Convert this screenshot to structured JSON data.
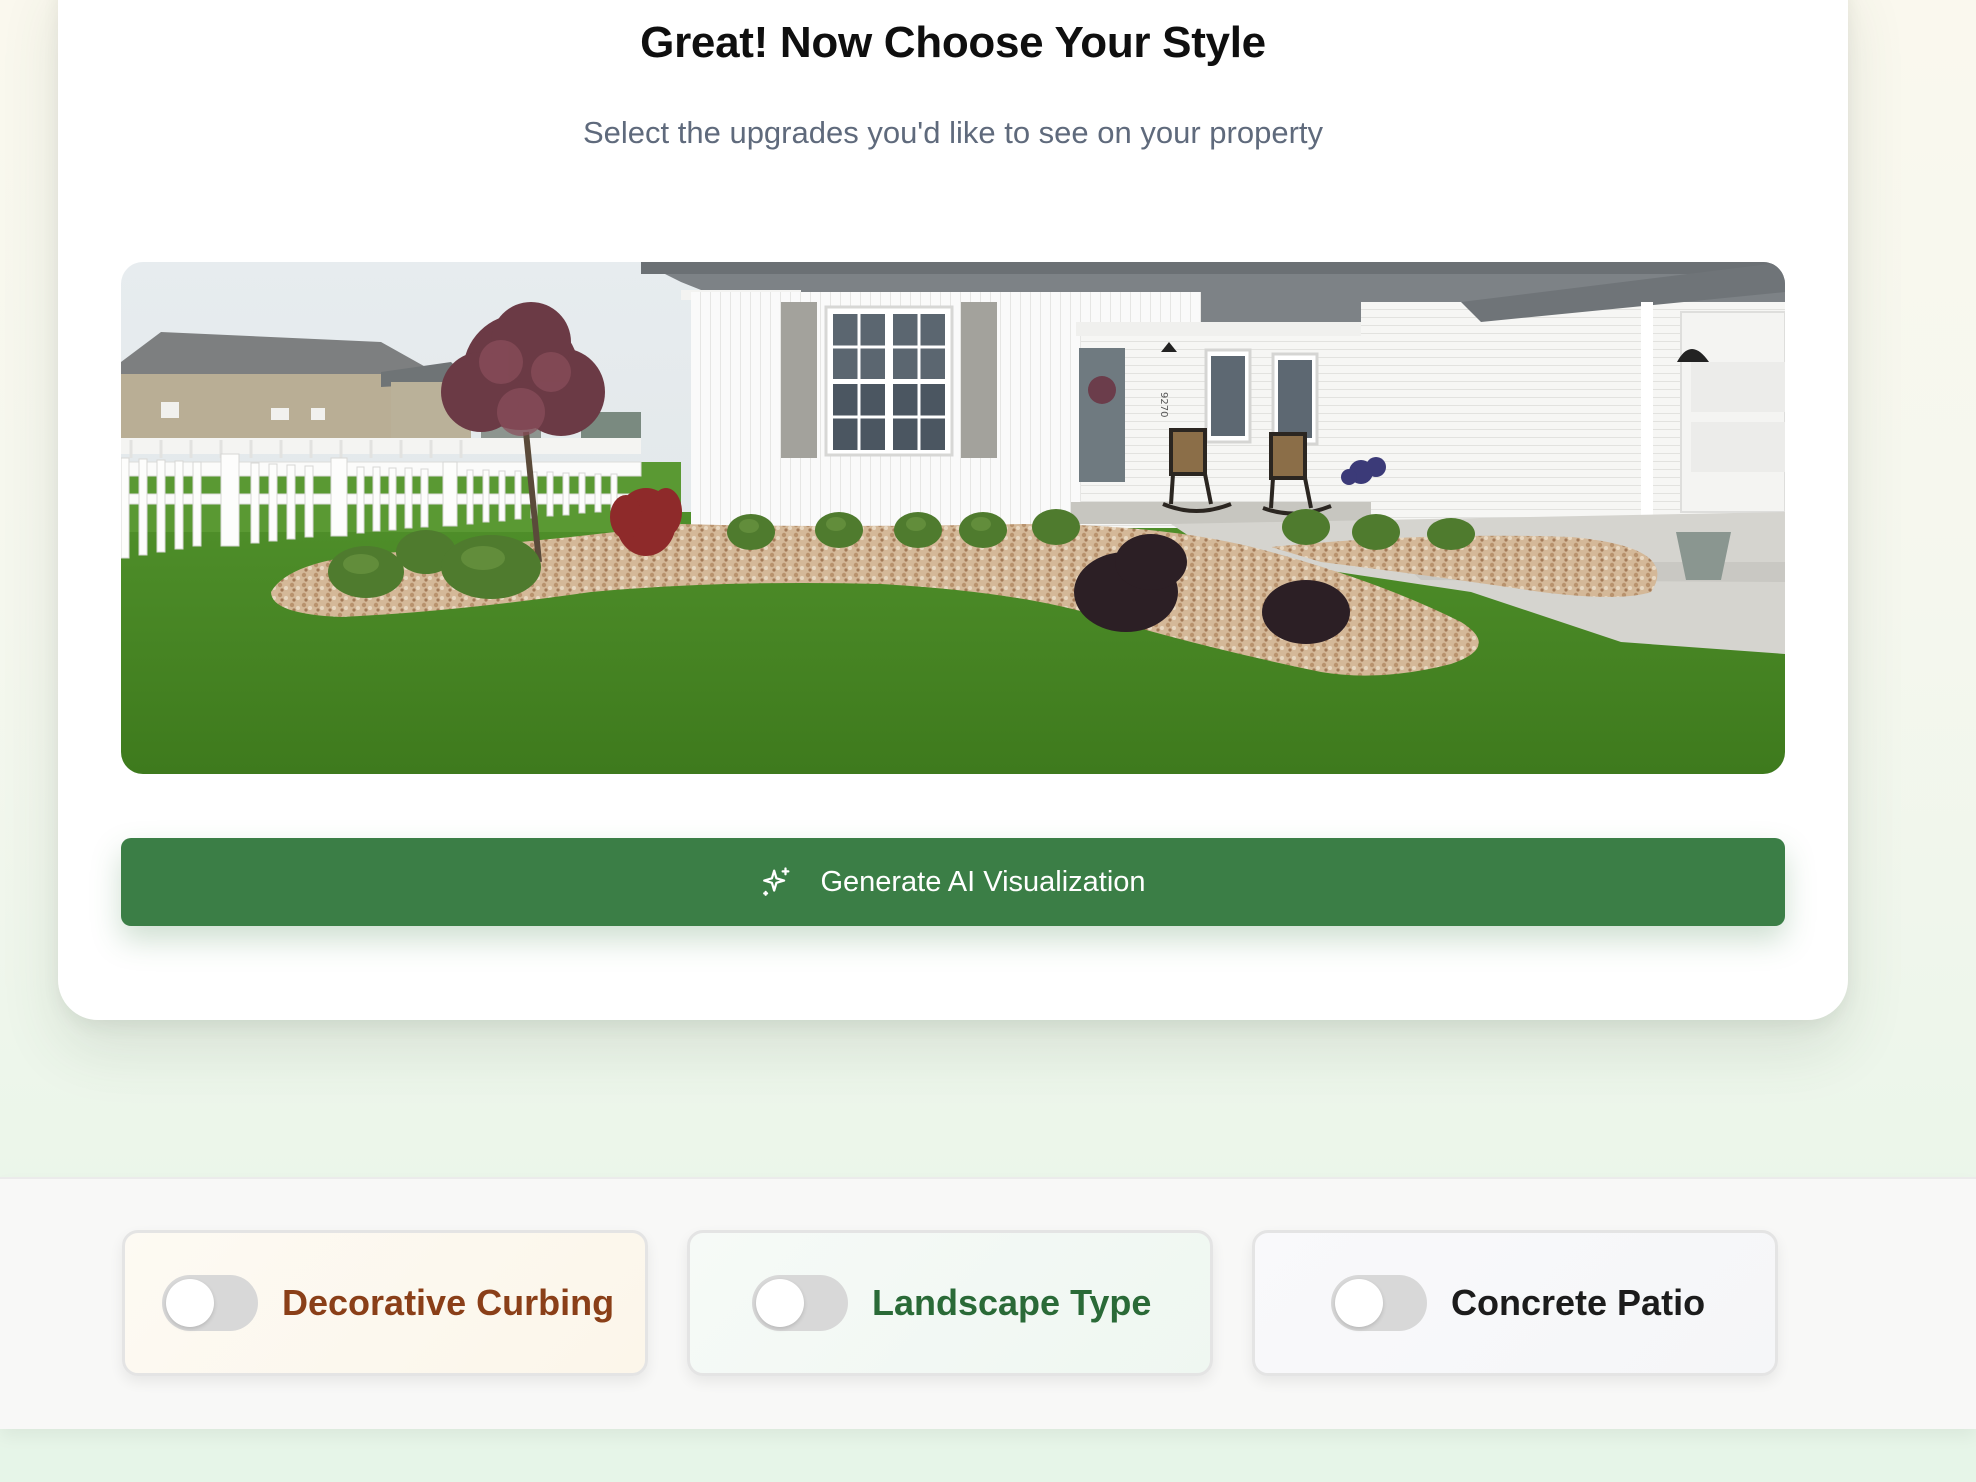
{
  "header": {
    "title": "Great! Now Choose Your Style",
    "subtitle": "Select the upgrades you'd like to see on your property"
  },
  "photo": {
    "house_number": "9270"
  },
  "actions": {
    "generate_label": "Generate AI Visualization",
    "generate_icon": "sparkles-icon"
  },
  "options": [
    {
      "label": "Decorative Curbing",
      "enabled": false,
      "color": "#8a3f18"
    },
    {
      "label": "Landscape Type",
      "enabled": false,
      "color": "#2a6a37"
    },
    {
      "label": "Concrete Patio",
      "enabled": false,
      "color": "#1c1c1c"
    }
  ],
  "colors": {
    "primary_button": "#3b7e46",
    "toggle_off": "#d8d8d8"
  }
}
